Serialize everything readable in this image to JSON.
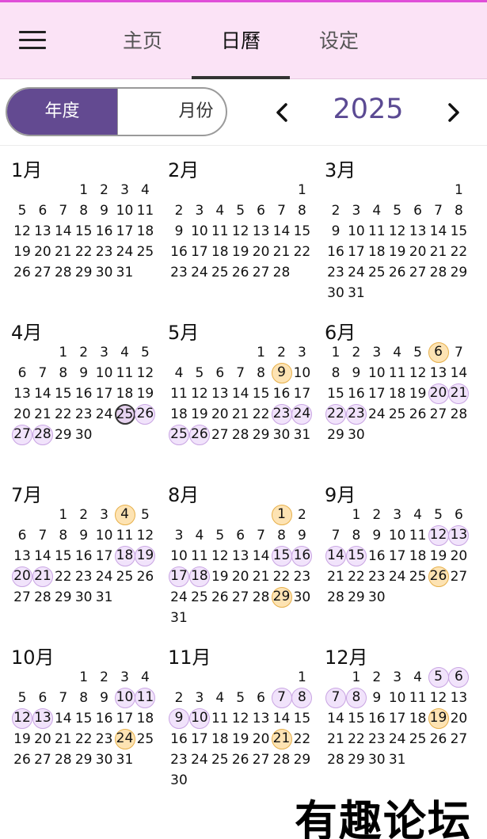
{
  "header": {
    "tabs": [
      {
        "label": "主页",
        "active": false
      },
      {
        "label": "日曆",
        "active": true
      },
      {
        "label": "设定",
        "active": false
      }
    ]
  },
  "view_toggle": {
    "year_label": "年度",
    "month_label": "月份",
    "selected": "年度"
  },
  "year": "2025",
  "weekday_start": "Sunday",
  "highlight_colors": {
    "purple": "#f1e3fb",
    "yellow": "#fde3b3",
    "today": "#e6d2ef",
    "accent": "#634a91"
  },
  "months": [
    {
      "title": "1月",
      "offset": 3,
      "days": 31,
      "purple": [],
      "yellow": [],
      "today": null
    },
    {
      "title": "2月",
      "offset": 6,
      "days": 28,
      "purple": [],
      "yellow": [],
      "today": null
    },
    {
      "title": "3月",
      "offset": 6,
      "days": 31,
      "purple": [],
      "yellow": [],
      "today": null
    },
    {
      "title": "4月",
      "offset": 2,
      "days": 30,
      "purple": [
        26,
        27,
        28
      ],
      "yellow": [],
      "today": 25
    },
    {
      "title": "5月",
      "offset": 4,
      "days": 31,
      "purple": [
        23,
        24,
        25,
        26
      ],
      "yellow": [
        9
      ],
      "today": null
    },
    {
      "title": "6月",
      "offset": 0,
      "days": 30,
      "purple": [
        20,
        21,
        22,
        23
      ],
      "yellow": [
        6
      ],
      "today": null
    },
    {
      "title": "7月",
      "offset": 2,
      "days": 31,
      "purple": [
        18,
        19,
        20,
        21
      ],
      "yellow": [
        4
      ],
      "today": null
    },
    {
      "title": "8月",
      "offset": 5,
      "days": 31,
      "purple": [
        15,
        16,
        17,
        18
      ],
      "yellow": [
        1,
        29
      ],
      "today": null
    },
    {
      "title": "9月",
      "offset": 1,
      "days": 30,
      "purple": [
        12,
        13,
        14,
        15
      ],
      "yellow": [
        26
      ],
      "today": null
    },
    {
      "title": "10月",
      "offset": 3,
      "days": 31,
      "purple": [
        10,
        11,
        12,
        13
      ],
      "yellow": [
        24
      ],
      "today": null
    },
    {
      "title": "11月",
      "offset": 6,
      "days": 30,
      "purple": [
        7,
        8,
        9,
        10
      ],
      "yellow": [
        21
      ],
      "today": null
    },
    {
      "title": "12月",
      "offset": 1,
      "days": 31,
      "purple": [
        5,
        6,
        7,
        8
      ],
      "yellow": [
        19
      ],
      "today": null
    }
  ],
  "watermark": "有趣论坛"
}
